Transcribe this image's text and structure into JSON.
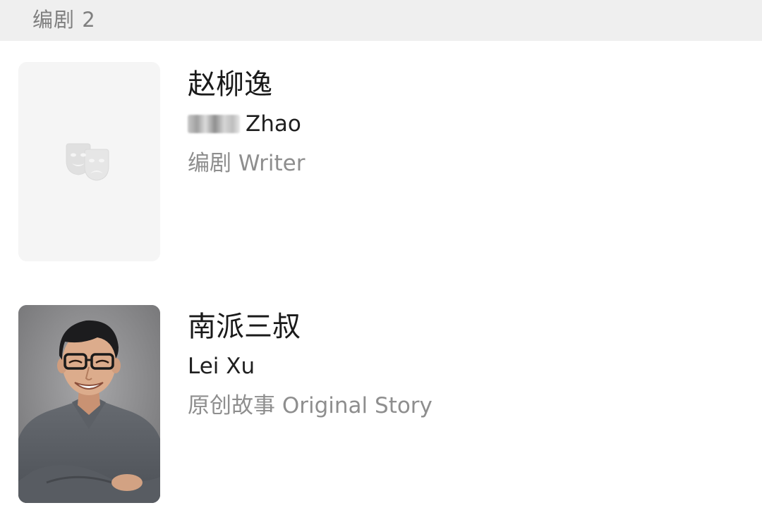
{
  "section": {
    "title": "编剧 2"
  },
  "credits": [
    {
      "name_cn": "赵柳逸",
      "name_en": "Zhao",
      "role": "编剧 Writer",
      "photo_icon": "theater-masks-icon"
    },
    {
      "name_cn": "南派三叔",
      "name_en": "Lei Xu",
      "role": "原创故事 Original Story",
      "photo_icon": "person-photo"
    }
  ]
}
